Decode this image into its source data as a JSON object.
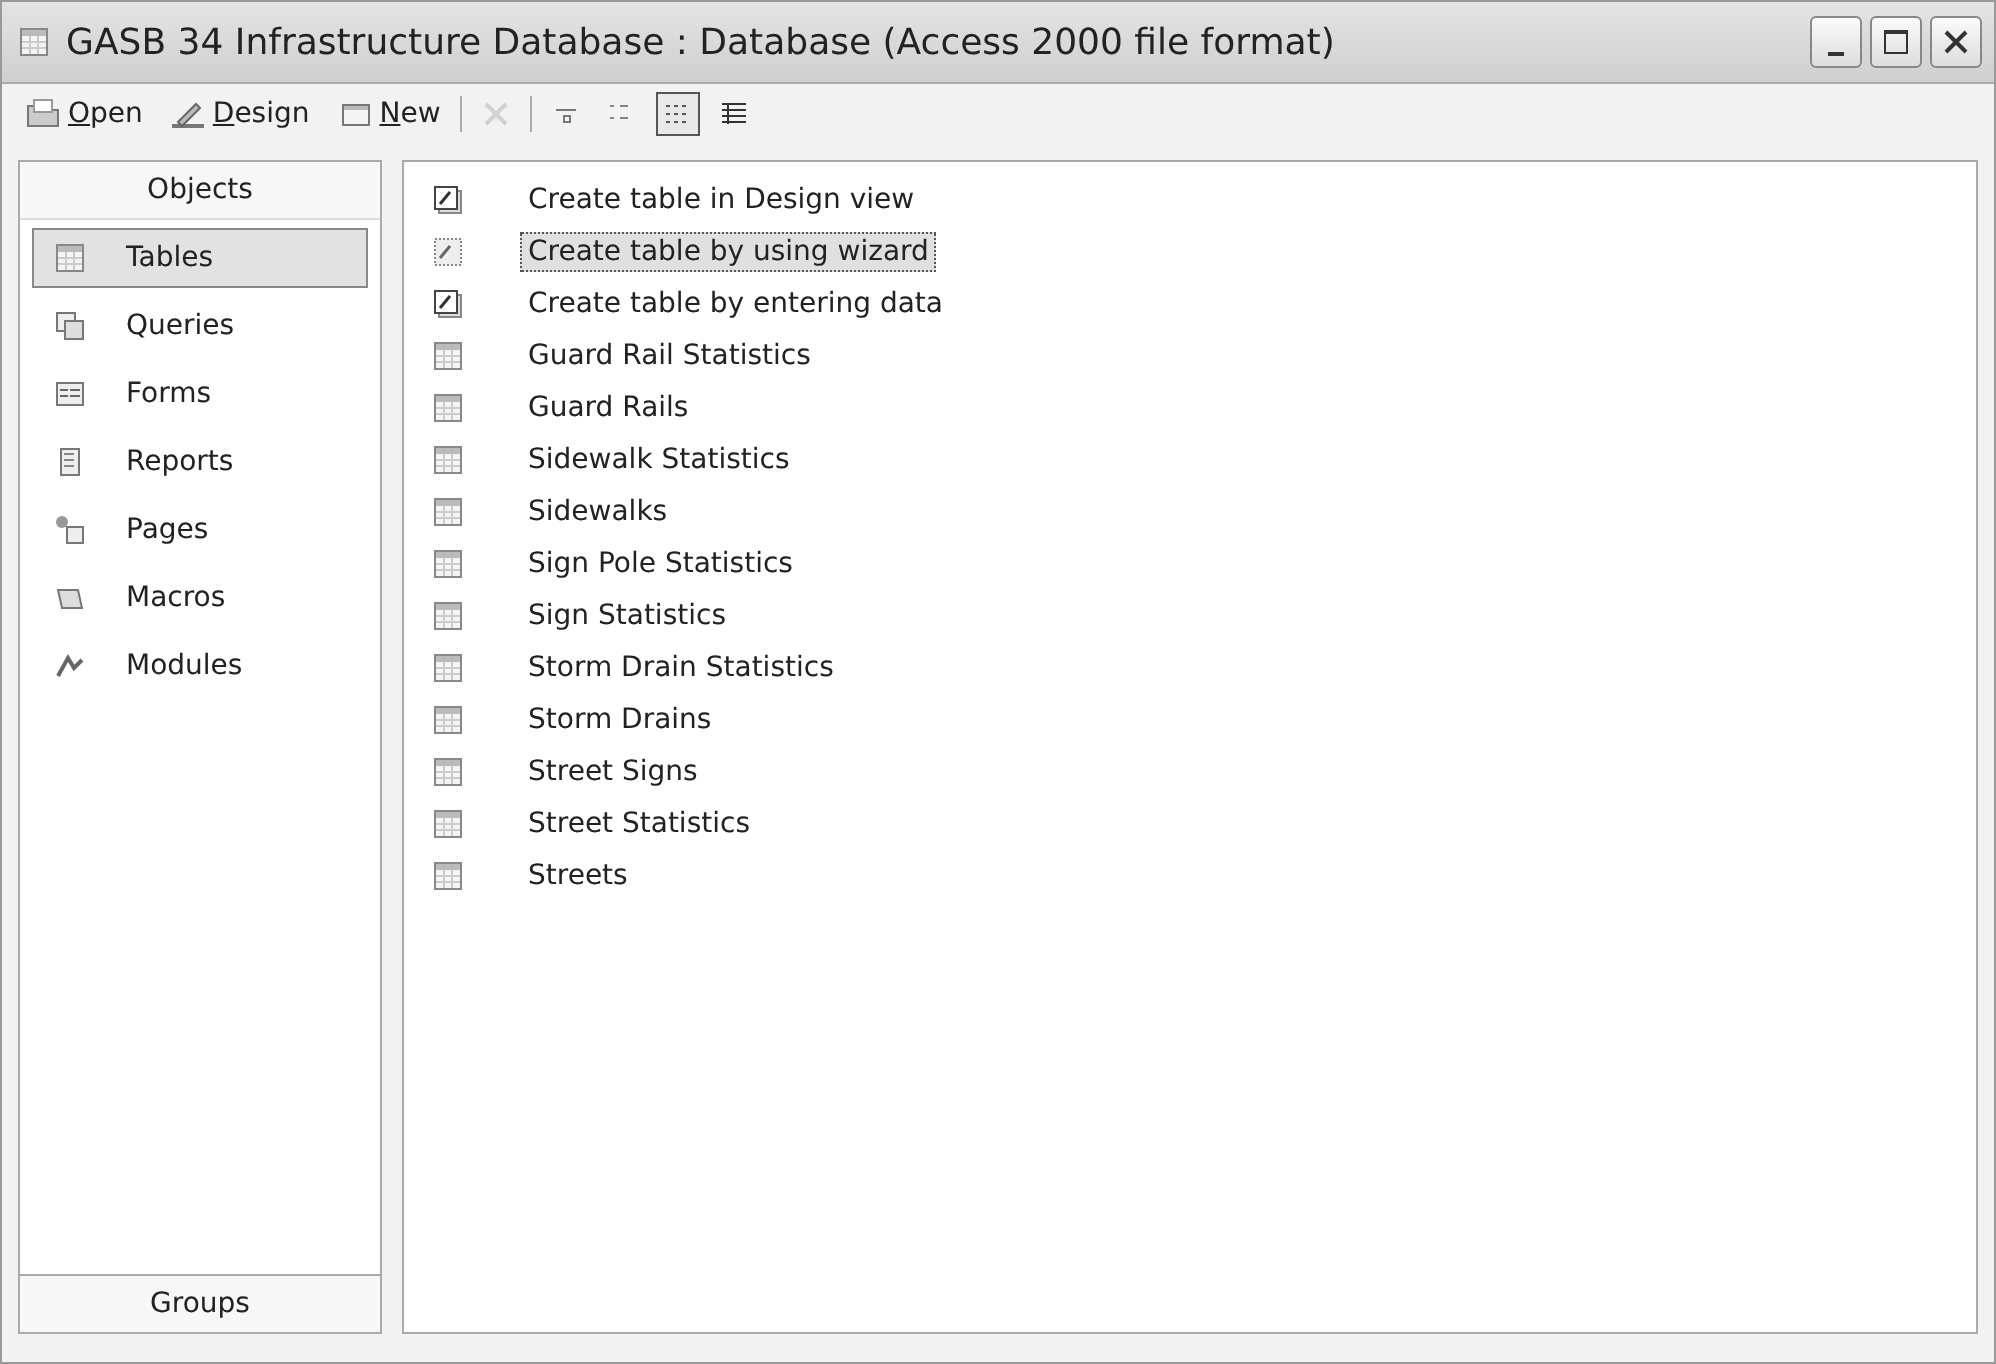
{
  "window": {
    "title": "GASB 34 Infrastructure Database : Database (Access 2000 file format)"
  },
  "toolbar": [
    {
      "kind": "button",
      "label": "Open",
      "disabled": false
    },
    {
      "kind": "button",
      "label": "Design",
      "disabled": false
    },
    {
      "kind": "button",
      "label": "New",
      "disabled": false
    },
    {
      "kind": "separator"
    },
    {
      "kind": "icon",
      "disabled": true,
      "selected": false
    },
    {
      "kind": "separator"
    },
    {
      "kind": "icon",
      "disabled": false,
      "selected": false
    },
    {
      "kind": "icon",
      "disabled": false,
      "selected": false
    },
    {
      "kind": "icon",
      "disabled": false,
      "selected": true
    },
    {
      "kind": "icon",
      "disabled": false,
      "selected": false
    }
  ],
  "sidebar": {
    "header": "Objects",
    "items": [
      {
        "label": "Tables",
        "selected": true
      },
      {
        "label": "Queries",
        "selected": false
      },
      {
        "label": "Forms",
        "selected": false
      },
      {
        "label": "Reports",
        "selected": false
      },
      {
        "label": "Pages",
        "selected": false
      },
      {
        "label": "Macros",
        "selected": false
      },
      {
        "label": "Modules",
        "selected": false
      }
    ],
    "footer": "Groups"
  },
  "list": [
    {
      "label": "Create table in Design view",
      "kind": "shortcut",
      "selected": false
    },
    {
      "label": "Create table by using wizard",
      "kind": "wizard",
      "selected": true
    },
    {
      "label": "Create table by entering data",
      "kind": "shortcut",
      "selected": false
    },
    {
      "label": "Guard Rail Statistics",
      "kind": "table",
      "selected": false
    },
    {
      "label": "Guard Rails",
      "kind": "table",
      "selected": false
    },
    {
      "label": "Sidewalk Statistics",
      "kind": "table",
      "selected": false
    },
    {
      "label": "Sidewalks",
      "kind": "table",
      "selected": false
    },
    {
      "label": "Sign Pole Statistics",
      "kind": "table",
      "selected": false
    },
    {
      "label": "Sign Statistics",
      "kind": "table",
      "selected": false
    },
    {
      "label": "Storm Drain Statistics",
      "kind": "table",
      "selected": false
    },
    {
      "label": "Storm Drains",
      "kind": "table",
      "selected": false
    },
    {
      "label": "Street Signs",
      "kind": "table",
      "selected": false
    },
    {
      "label": "Street Statistics",
      "kind": "table",
      "selected": false
    },
    {
      "label": "Streets",
      "kind": "table",
      "selected": false
    }
  ]
}
